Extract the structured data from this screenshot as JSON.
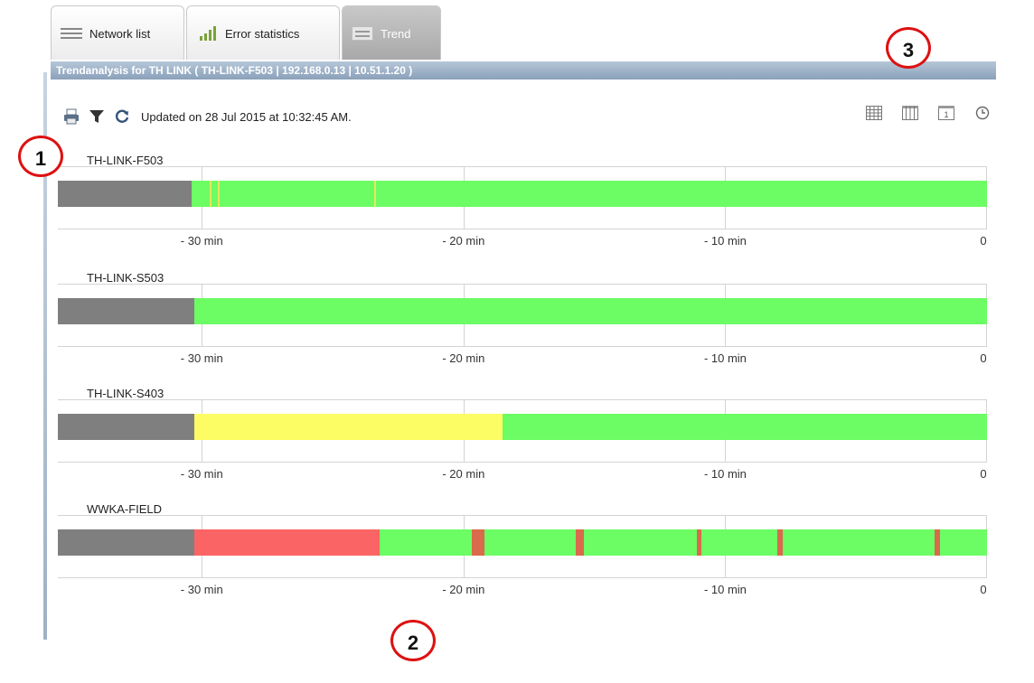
{
  "tabs": [
    {
      "label": "Network list",
      "icon": "list-icon",
      "active": false
    },
    {
      "label": "Error statistics",
      "icon": "bar-chart-icon",
      "active": false
    },
    {
      "label": "Trend",
      "icon": "trend-icon",
      "active": true
    }
  ],
  "title_bar": "Trendanalysis for TH LINK ( TH-LINK-F503 | 192.168.0.13 | 10.51.1.20 )",
  "toolbar": {
    "icons": [
      "print-icon",
      "filter-icon",
      "refresh-icon"
    ],
    "updated_text": "Updated on 28 Jul 2015 at 10:32:45 AM."
  },
  "view_icons": [
    "calendar-grid-icon",
    "columns-icon",
    "day-icon",
    "clock-icon"
  ],
  "colors": {
    "gray": "#7f7f7f",
    "green": "#6cfc64",
    "yellow": "#fcfc64",
    "red": "#fb6464",
    "marker_yellow": "#e6e85a",
    "marker_red": "#d96a4c"
  },
  "chart_data": {
    "type": "timeline",
    "x_range_minutes": [
      -35.5,
      0
    ],
    "ticks": [
      {
        "value": -30,
        "label": "- 30 min"
      },
      {
        "value": -20,
        "label": "- 20 min"
      },
      {
        "value": -10,
        "label": "- 10 min"
      },
      {
        "value": 0,
        "label": "0"
      }
    ],
    "series": [
      {
        "name": "TH-LINK-F503",
        "segments": [
          {
            "from": -35.5,
            "to": -30.4,
            "state": "gray"
          },
          {
            "from": -30.4,
            "to": 0,
            "state": "green"
          }
        ],
        "markers": [
          {
            "at": -29.7,
            "state": "marker_yellow"
          },
          {
            "at": -29.4,
            "state": "marker_yellow"
          },
          {
            "at": -23.4,
            "state": "marker_yellow"
          }
        ]
      },
      {
        "name": "TH-LINK-S503",
        "segments": [
          {
            "from": -35.5,
            "to": -30.3,
            "state": "gray"
          },
          {
            "from": -30.3,
            "to": 0,
            "state": "green"
          }
        ],
        "markers": []
      },
      {
        "name": "TH-LINK-S403",
        "segments": [
          {
            "from": -35.5,
            "to": -30.3,
            "state": "gray"
          },
          {
            "from": -30.3,
            "to": -18.5,
            "state": "yellow"
          },
          {
            "from": -18.5,
            "to": 0,
            "state": "green"
          }
        ],
        "markers": []
      },
      {
        "name": "WWKA-FIELD",
        "segments": [
          {
            "from": -35.5,
            "to": -30.3,
            "state": "gray"
          },
          {
            "from": -30.3,
            "to": -23.2,
            "state": "red"
          },
          {
            "from": -23.2,
            "to": 0,
            "state": "green"
          }
        ],
        "markers": [
          {
            "at": -19.7,
            "state": "marker_red",
            "width": 0.5
          },
          {
            "at": -15.7,
            "state": "marker_red",
            "width": 0.3
          },
          {
            "at": -11.1,
            "state": "marker_red",
            "width": 0.2
          },
          {
            "at": -8.0,
            "state": "marker_red",
            "width": 0.2
          },
          {
            "at": -2.0,
            "state": "marker_red",
            "width": 0.2
          }
        ]
      }
    ]
  },
  "callouts": [
    "1",
    "2",
    "3"
  ]
}
